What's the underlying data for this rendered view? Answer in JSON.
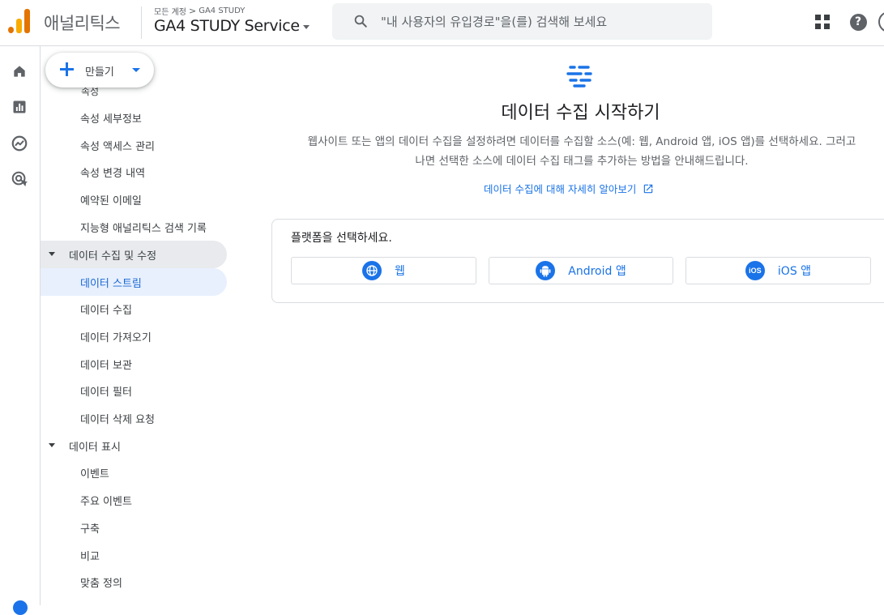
{
  "header": {
    "app_title": "애널리틱스",
    "breadcrumb": {
      "account": "모든 계정",
      "separator": ">",
      "property": "GA4 STUDY"
    },
    "property_name": "GA4 STUDY Service",
    "search_placeholder": "\"내 사용자의 유입경로\"을(를) 검색해 보세요",
    "icons": [
      "apps-grid-icon",
      "help-icon",
      "account-avatar"
    ]
  },
  "rail": {
    "items": [
      "home-icon",
      "reports-icon",
      "explore-icon",
      "advertising-icon"
    ]
  },
  "nav": {
    "create_label": "만들기",
    "clipped_label": "속성",
    "items": [
      {
        "label": "속성 세부정보",
        "type": "sub"
      },
      {
        "label": "속성 액세스 관리",
        "type": "sub"
      },
      {
        "label": "속성 변경 내역",
        "type": "sub"
      },
      {
        "label": "예약된 이메일",
        "type": "sub"
      },
      {
        "label": "지능형 애널리틱스 검색 기록",
        "type": "sub"
      },
      {
        "label": "데이터 수집 및 수정",
        "type": "section",
        "expanded": true
      },
      {
        "label": "데이터 스트림",
        "type": "sub",
        "active": true
      },
      {
        "label": "데이터 수집",
        "type": "sub"
      },
      {
        "label": "데이터 가져오기",
        "type": "sub"
      },
      {
        "label": "데이터 보관",
        "type": "sub"
      },
      {
        "label": "데이터 필터",
        "type": "sub"
      },
      {
        "label": "데이터 삭제 요청",
        "type": "sub"
      },
      {
        "label": "데이터 표시",
        "type": "section",
        "expanded": true
      },
      {
        "label": "이벤트",
        "type": "sub"
      },
      {
        "label": "주요 이벤트",
        "type": "sub"
      },
      {
        "label": "구축",
        "type": "sub"
      },
      {
        "label": "비교",
        "type": "sub"
      },
      {
        "label": "맞춤 정의",
        "type": "sub"
      }
    ]
  },
  "main": {
    "title": "데이터 수집 시작하기",
    "description": "웹사이트 또는 앱의 데이터 수집을 설정하려면 데이터를 수집할 소스(예: 웹, Android 앱, iOS 앱)를 선택하세요. 그러고 나면 선택한 소스에 데이터 수집 태그를 추가하는 방법을 안내해드립니다.",
    "learn_more": "데이터 수집에 대해 자세히 알아보기",
    "platform_prompt": "플랫폼을 선택하세요.",
    "platforms": [
      {
        "label": "웹",
        "icon": "globe-icon"
      },
      {
        "label": "Android 앱",
        "icon": "android-icon"
      },
      {
        "label": "iOS 앱",
        "icon": "ios-icon",
        "icon_text": "iOS"
      }
    ]
  },
  "colors": {
    "accent": "#1a73e8",
    "active_bg": "#e8f0fe",
    "section_hover_bg": "#e8eaed",
    "logo": [
      "#f9ab00",
      "#e37400"
    ]
  }
}
